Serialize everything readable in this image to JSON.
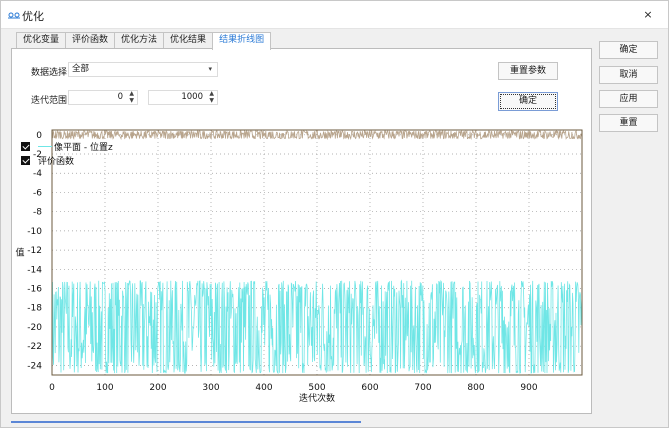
{
  "window": {
    "title": "优化",
    "close_glyph": "×"
  },
  "tabs": [
    {
      "label": "优化变量",
      "active": false
    },
    {
      "label": "评价函数",
      "active": false
    },
    {
      "label": "优化方法",
      "active": false
    },
    {
      "label": "优化结果",
      "active": false
    },
    {
      "label": "结果折线图",
      "active": true
    }
  ],
  "controls": {
    "data_select_label": "数据选择",
    "data_select_value": "全部",
    "iter_range_label": "迭代范围",
    "iter_from": "0",
    "iter_to": "1000",
    "reset_params_label": "重置参数",
    "confirm_label": "确定"
  },
  "side_buttons": {
    "ok": "确定",
    "cancel": "取消",
    "apply": "应用",
    "reset": "重置"
  },
  "legend": [
    {
      "label": "像平面 - 位置z",
      "checked": true
    },
    {
      "label": "评价函数",
      "checked": true
    }
  ],
  "chart_data": {
    "type": "line",
    "xlabel": "迭代次数",
    "ylabel": "值",
    "xlim": [
      0,
      1000
    ],
    "ylim": [
      -25,
      0.5
    ],
    "x_ticks": [
      0,
      100,
      200,
      300,
      400,
      500,
      600,
      700,
      800,
      900
    ],
    "y_ticks": [
      0,
      -2,
      -4,
      -6,
      -8,
      -10,
      -12,
      -14,
      -16,
      -18,
      -20,
      -22,
      -24
    ],
    "grid": true,
    "series": [
      {
        "name": "像平面 - 位置z",
        "color": "#6fe6e6",
        "y_min": -24.8,
        "y_max": -15.2,
        "points": 1000
      },
      {
        "name": "评价函数",
        "color": "#b8a48c",
        "y_min": -0.4,
        "y_max": 0.4,
        "points": 1000
      }
    ]
  }
}
